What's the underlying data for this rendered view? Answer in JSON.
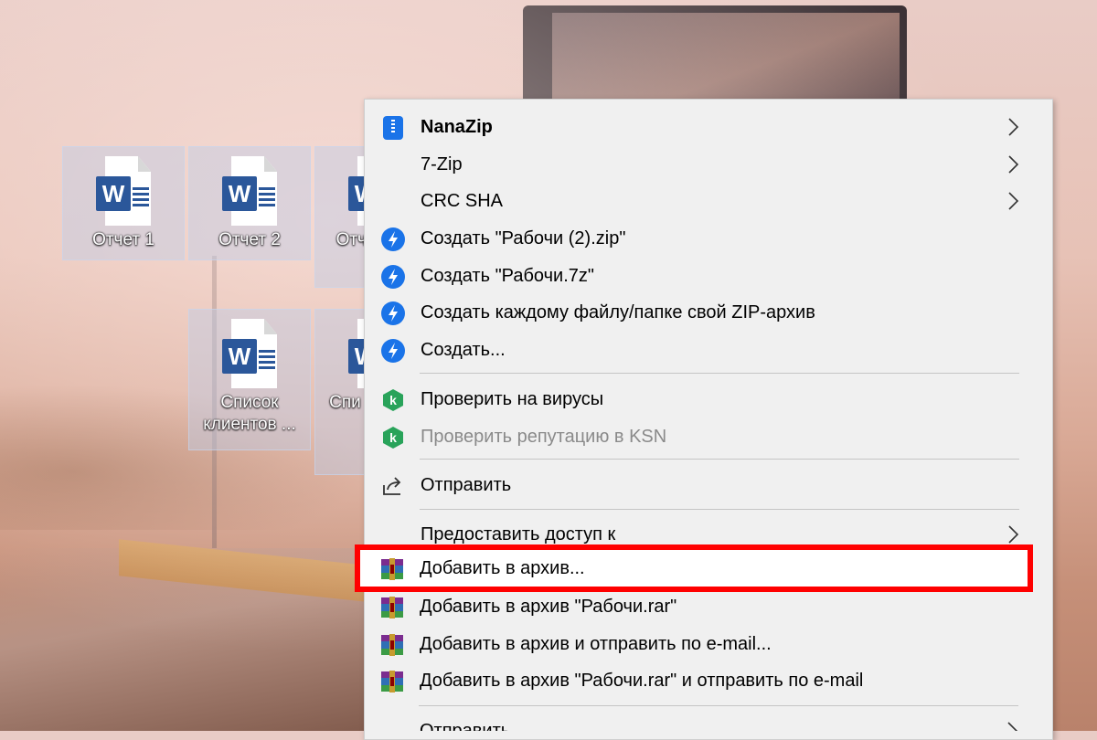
{
  "desktop": {
    "icons": [
      {
        "label": "Отчет 1"
      },
      {
        "label": "Отчет 2"
      },
      {
        "label": "Отч... зам"
      },
      {
        "label": "Список клиентов ..."
      },
      {
        "label": "Спи клие М"
      }
    ]
  },
  "context_menu": {
    "items": [
      {
        "label": "NanaZip",
        "icon": "nanazip-icon",
        "submenu": true,
        "bold": true
      },
      {
        "label": "7-Zip",
        "icon": "",
        "submenu": true
      },
      {
        "label": "CRC SHA",
        "icon": "",
        "submenu": true
      },
      {
        "label": "Создать \"Рабочи (2).zip\"",
        "icon": "bolt-icon"
      },
      {
        "label": "Создать \"Рабочи.7z\"",
        "icon": "bolt-icon"
      },
      {
        "label": "Создать каждому файлу/папке свой ZIP-архив",
        "icon": "bolt-icon"
      },
      {
        "label": "Создать...",
        "icon": "bolt-icon"
      },
      {
        "label": "Проверить на вирусы",
        "icon": "kaspersky-icon"
      },
      {
        "label": "Проверить репутацию в KSN",
        "icon": "kaspersky-icon",
        "disabled": true
      },
      {
        "label": "Отправить",
        "icon": "share-icon"
      },
      {
        "label": "Предоставить доступ к",
        "icon": "",
        "submenu": true
      },
      {
        "label": "Добавить в архив...",
        "icon": "winrar-icon",
        "highlighted": true
      },
      {
        "label": "Добавить в архив \"Рабочи.rar\"",
        "icon": "winrar-icon"
      },
      {
        "label": "Добавить в архив и отправить по e-mail...",
        "icon": "winrar-icon"
      },
      {
        "label": "Добавить в архив \"Рабочи.rar\" и отправить по e-mail",
        "icon": "winrar-icon"
      },
      {
        "label": "Отправить",
        "icon": "",
        "submenu": true
      }
    ]
  },
  "colors": {
    "highlight_border": "#ff0000",
    "menu_background": "#f0f0f0",
    "accent_blue": "#1a73e8",
    "kaspersky_green": "#29a35a",
    "word_blue": "#2b579a"
  }
}
